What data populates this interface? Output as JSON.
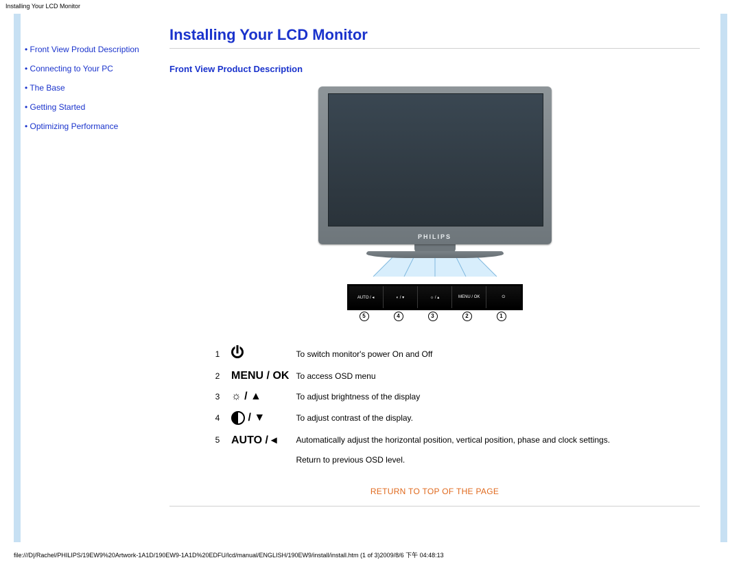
{
  "header": {
    "tab_title": "Installing Your LCD Monitor"
  },
  "sidebar": {
    "items": [
      {
        "label": "Front View Produt Description"
      },
      {
        "label": "Connecting to Your PC"
      },
      {
        "label": "The Base"
      },
      {
        "label": "Getting Started"
      },
      {
        "label": "Optimizing Performance"
      }
    ]
  },
  "main": {
    "title": "Installing Your LCD Monitor",
    "section_heading": "Front View Product Description",
    "monitor_brand": "PHILIPS",
    "button_bar": {
      "cells": [
        "AUTO / ◂",
        "◐ / ▾",
        "☼ / ▴",
        "MENU / OK",
        "⏻"
      ],
      "numbers": [
        "5",
        "4",
        "3",
        "2",
        "1"
      ]
    },
    "controls": [
      {
        "num": "1",
        "icon_key": "power",
        "icon_text": "",
        "desc": "To switch monitor's power On and Off"
      },
      {
        "num": "2",
        "icon_key": "menu",
        "icon_text": "MENU / OK",
        "desc": "To access OSD menu"
      },
      {
        "num": "3",
        "icon_key": "bright",
        "icon_text": "☼ / ▲",
        "desc": "To adjust brightness of the display"
      },
      {
        "num": "4",
        "icon_key": "contrast",
        "icon_text": " / ▼",
        "desc": "To adjust contrast of the display."
      },
      {
        "num": "5",
        "icon_key": "auto",
        "icon_text": "AUTO / ◂",
        "desc": "Automatically adjust the horizontal position, vertical position, phase and clock settings."
      }
    ],
    "controls_note": "Return to previous OSD level.",
    "return_top": "RETURN TO TOP OF THE PAGE"
  },
  "footer": {
    "path": "file:///D|/Rachel/PHILIPS/19EW9%20Artwork-1A1D/190EW9-1A1D%20EDFU/lcd/manual/ENGLISH/190EW9/install/install.htm (1 of 3)2009/8/6 下午 04:48:13"
  }
}
